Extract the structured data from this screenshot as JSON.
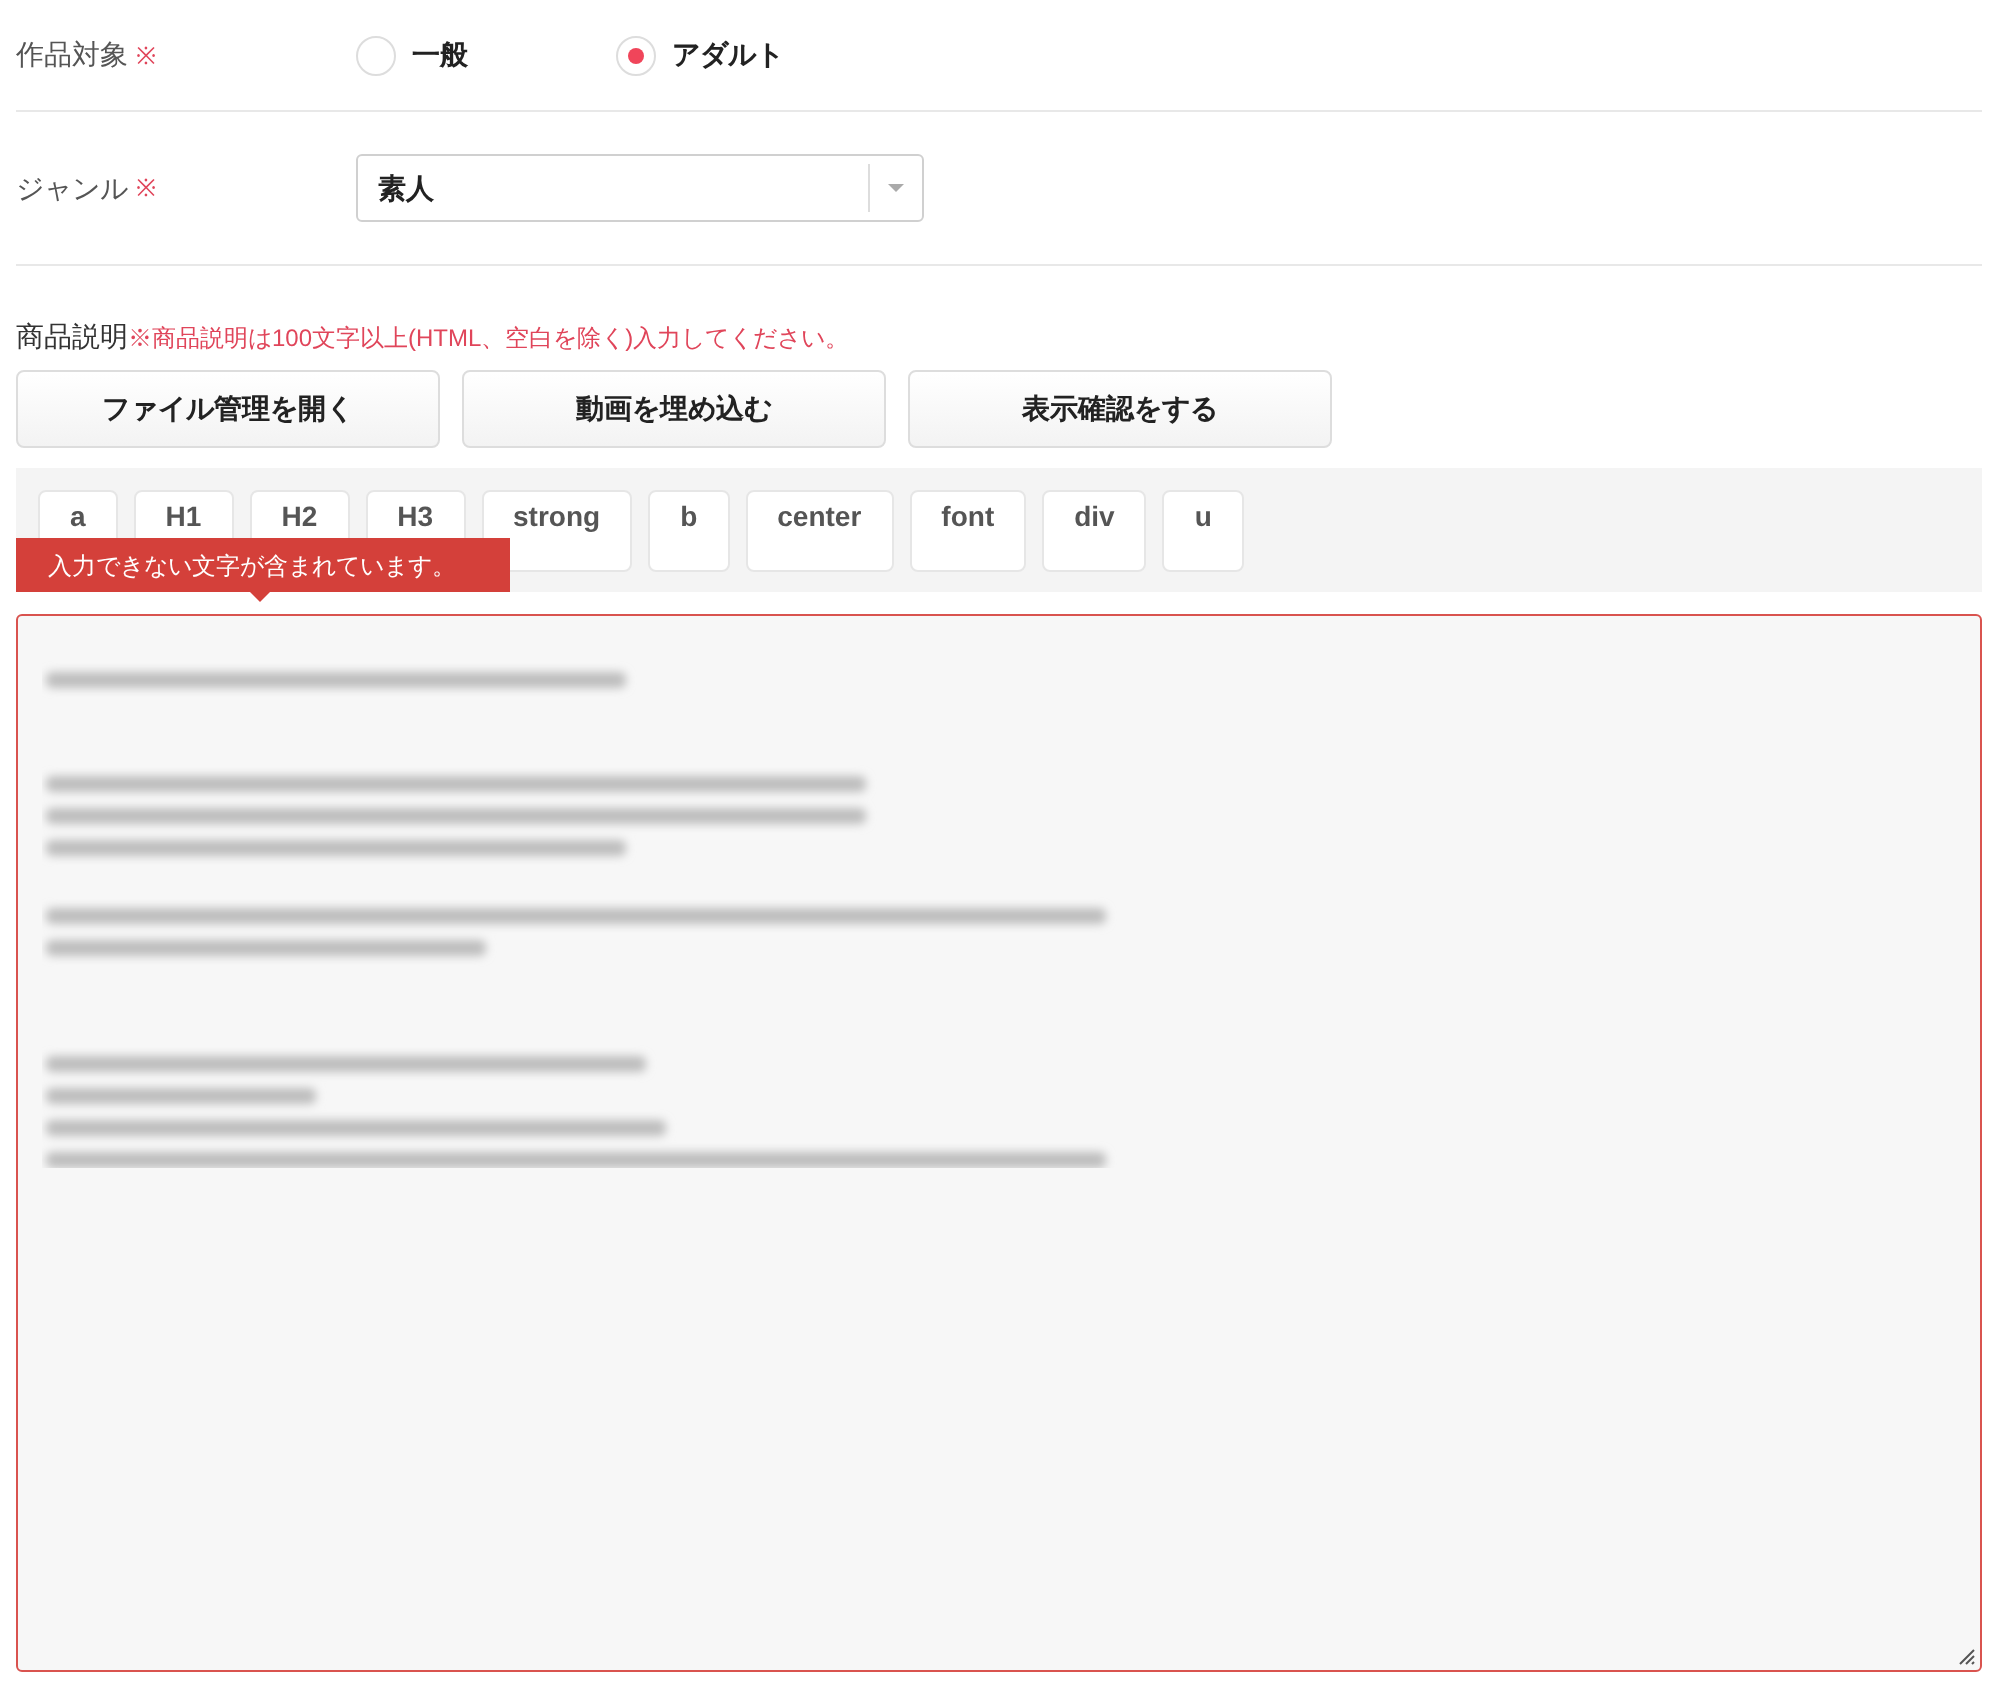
{
  "target": {
    "label": "作品対象",
    "required_mark": "※",
    "options": [
      {
        "label": "一般",
        "selected": false
      },
      {
        "label": "アダルト",
        "selected": true
      }
    ]
  },
  "genre": {
    "label": "ジャンル",
    "required_mark": "※",
    "value": "素人"
  },
  "description": {
    "label": "商品説明",
    "note": "※商品説明は100文字以上(HTML、空白を除く)入力してください。",
    "buttons": [
      "ファイル管理を開く",
      "動画を埋め込む",
      "表示確認をする"
    ],
    "tags": [
      "a",
      "H1",
      "H2",
      "H3",
      "strong",
      "b",
      "center",
      "font",
      "div",
      "u"
    ],
    "error_tooltip": "入力できない文字が含まれています。",
    "has_error": true
  }
}
